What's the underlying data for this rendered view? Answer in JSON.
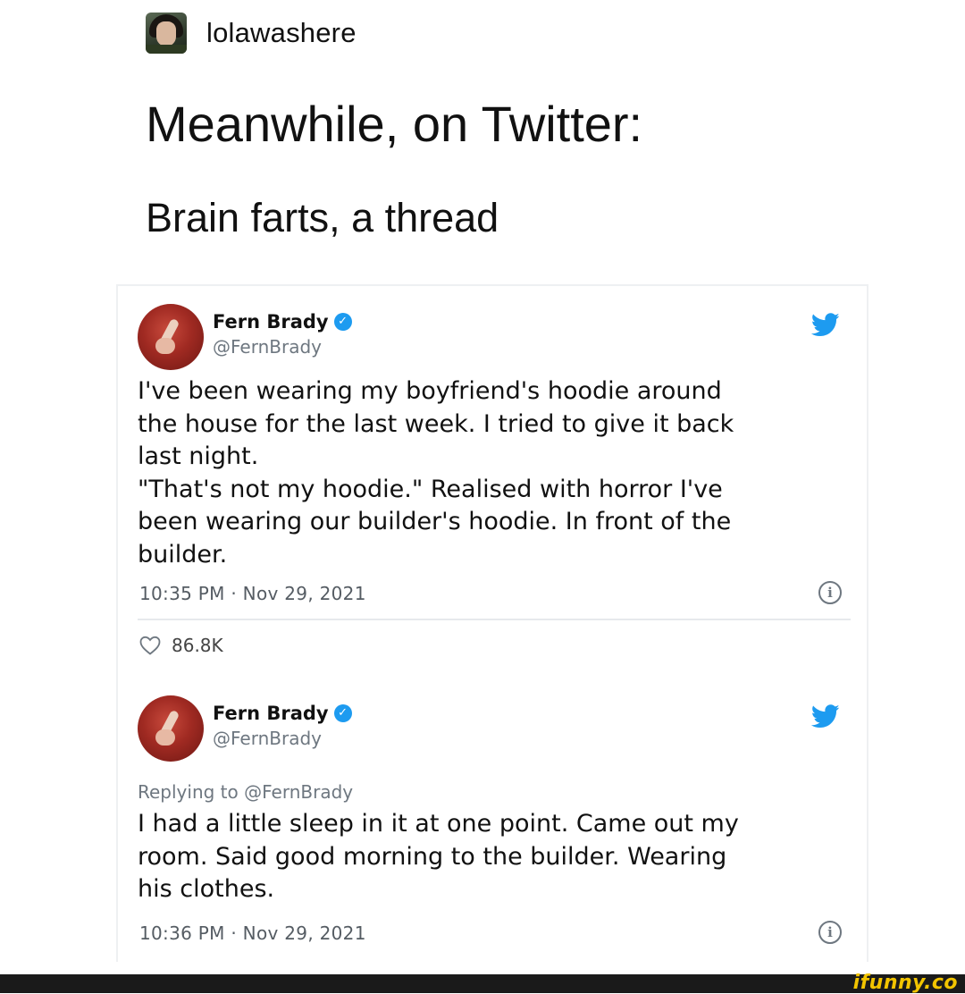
{
  "post": {
    "username": "lolawashere",
    "title": "Meanwhile, on Twitter:",
    "subtitle": "Brain farts, a thread"
  },
  "tweets": [
    {
      "name": "Fern Brady",
      "handle": "@FernBrady",
      "text": "I've been wearing my boyfriend's hoodie around\nthe house for the last week. I tried to give it back\nlast night.\n\"That's not my hoodie.\" Realised with horror I've\nbeen wearing our builder's hoodie. In front of the\nbuilder.",
      "timestamp": "10:35 PM · Nov 29, 2021",
      "likes": "86.8K"
    },
    {
      "name": "Fern Brady",
      "handle": "@FernBrady",
      "reply_to": "Replying to @FernBrady",
      "text": "I had a little sleep in it at one point. Came out my\nroom. Said good morning to the builder. Wearing\nhis clothes.",
      "timestamp": "10:36 PM · Nov 29, 2021"
    }
  ],
  "watermark": "ifunny.co",
  "colors": {
    "verified": "#1d9bf0",
    "twitter_bird": "#1d9bf0",
    "watermark": "#f2c400",
    "bottom_bar": "#1a1a1a"
  },
  "icons": [
    "avatar",
    "verified-badge-icon",
    "twitter-bird-icon",
    "info-icon",
    "heart-icon"
  ]
}
